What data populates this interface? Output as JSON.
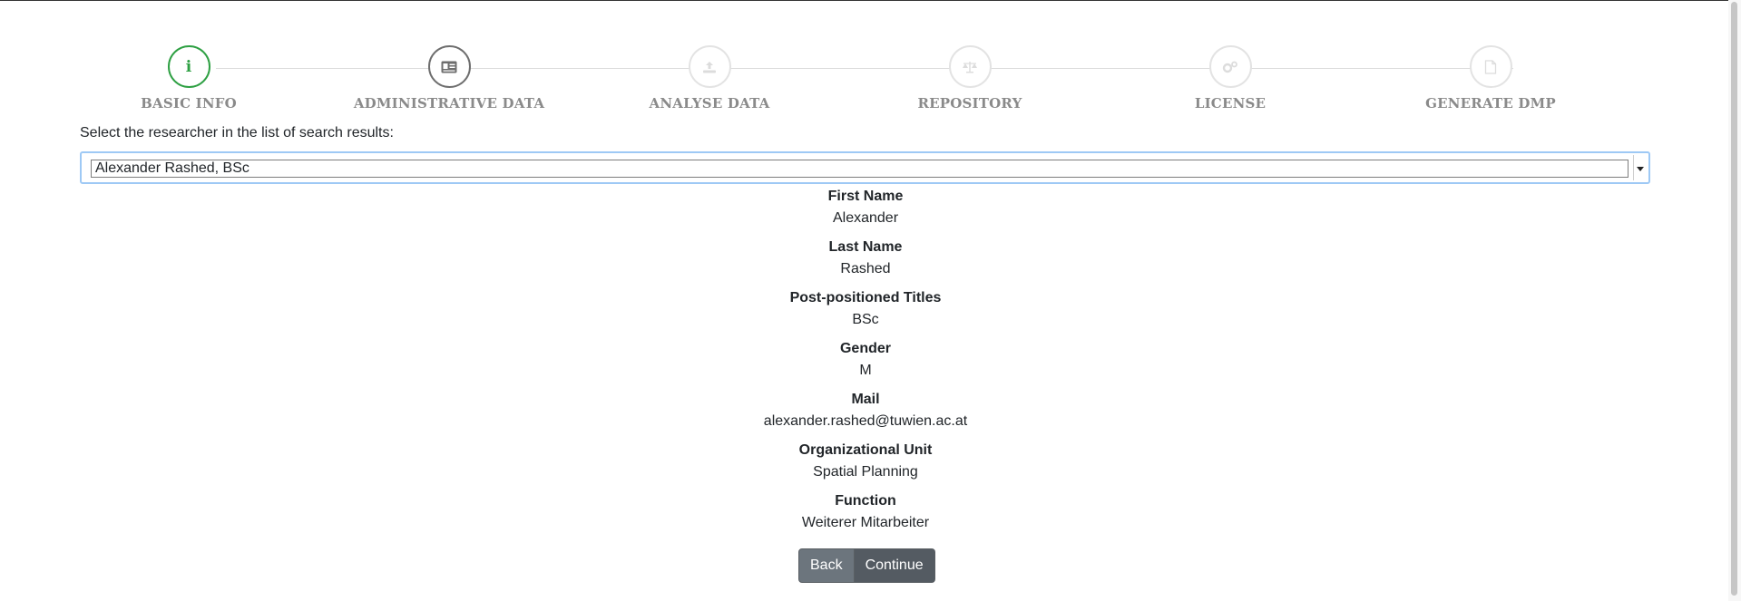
{
  "stepper": {
    "steps": [
      {
        "label": "BASIC INFO",
        "icon": "info-icon",
        "state": "active"
      },
      {
        "label": "ADMINISTRATIVE DATA",
        "icon": "id-card-icon",
        "state": "visited"
      },
      {
        "label": "ANALYSE DATA",
        "icon": "upload-icon",
        "state": "inactive"
      },
      {
        "label": "REPOSITORY",
        "icon": "balance-scale-icon",
        "state": "inactive"
      },
      {
        "label": "LICENSE",
        "icon": "cogs-icon",
        "state": "inactive"
      },
      {
        "label": "GENERATE DMP",
        "icon": "file-icon",
        "state": "inactive"
      }
    ],
    "colors": {
      "active": "#2ea043",
      "visited": "#6e6e6e",
      "inactive": "#e3e3e3"
    }
  },
  "search": {
    "label": "Select the researcher in the list of search results:",
    "selected": "Alexander Rashed, BSc"
  },
  "details": {
    "fields": [
      {
        "label": "First Name",
        "value": "Alexander"
      },
      {
        "label": "Last Name",
        "value": "Rashed"
      },
      {
        "label": "Post-positioned Titles",
        "value": "BSc"
      },
      {
        "label": "Gender",
        "value": "M"
      },
      {
        "label": "Mail",
        "value": "alexander.rashed@tuwien.ac.at"
      },
      {
        "label": "Organizational Unit",
        "value": "Spatial Planning"
      },
      {
        "label": "Function",
        "value": "Weiterer Mitarbeiter"
      }
    ]
  },
  "actions": {
    "back_label": "Back",
    "continue_label": "Continue"
  }
}
